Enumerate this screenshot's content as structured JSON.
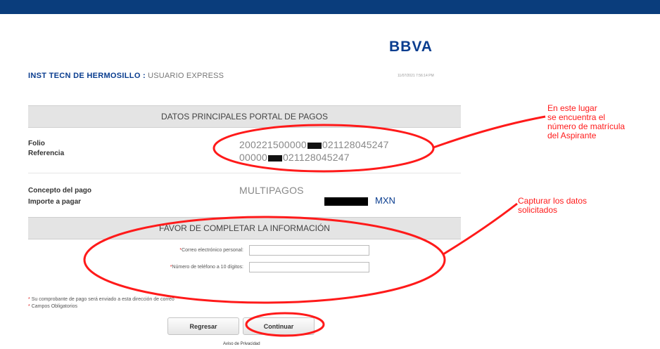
{
  "brand": {
    "logo_text": "BBVA"
  },
  "header": {
    "institution": "INST TECN DE HERMOSILLO :",
    "user_type": "USUARIO EXPRESS",
    "timestamp": "11/07/2021 7:56:14 PM"
  },
  "main_section": {
    "title": "DATOS PRINCIPALES PORTAL DE PAGOS",
    "folio_label": "Folio",
    "folio_prefix": "200221500000",
    "folio_suffix": "021128045247",
    "referencia_label": "Referencia",
    "referencia_prefix": "00000",
    "referencia_suffix": "021128045247",
    "concepto_label": "Concepto del pago",
    "concepto_value": "MULTIPAGOS",
    "importe_label": "Importe a pagar",
    "currency": "MXN"
  },
  "form_section": {
    "title": "FAVOR DE COMPLETAR LA INFORMACIÓN",
    "email_label": "Correo electrónico personal:",
    "phone_label": "Número de teléfono a 10 dígitos:",
    "email_value": "",
    "phone_value": ""
  },
  "notes": {
    "required_marker": "*",
    "receipt_note": "Su comprobante de pago será enviado a esta dirección de correo",
    "required_note": "Campos Obligatorios"
  },
  "actions": {
    "back_label": "Regresar",
    "continue_label": "Continuar",
    "privacy_label": "Aviso de Privacidad"
  },
  "annotations": {
    "matricula_line1": "En este lugar",
    "matricula_line2": "se encuentra el",
    "matricula_line3": "número de matrícula",
    "matricula_line4": "del Aspirante",
    "capture_line1": "Capturar los datos",
    "capture_line2": "solicitados"
  },
  "colors": {
    "brand_blue": "#0a3d8f",
    "top_bar": "#0a3d7c",
    "annotation_red": "#ff1a1a"
  }
}
